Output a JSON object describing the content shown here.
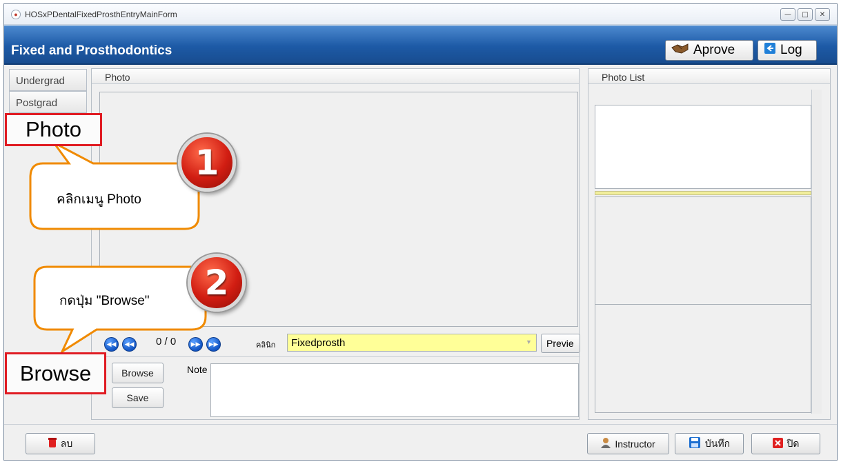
{
  "window": {
    "title": "HOSxPDentalFixedProsthEntryMainForm",
    "minimize": "—",
    "maximize": "□",
    "close": "✕"
  },
  "header": {
    "title": "Fixed and Prosthodontics",
    "approve_label": "Aprove",
    "log_label": "Log"
  },
  "tabs": [
    {
      "label": "Undergrad"
    },
    {
      "label": "Postgrad"
    }
  ],
  "photo_panel": {
    "title": "Photo",
    "page_counter": "0 / 0",
    "clinic_label": "คลินิก",
    "clinic_value": "Fixedprosth",
    "preview_label": "Previe",
    "browse_label": "Browse",
    "save_label": "Save",
    "note_label": "Note",
    "note_value": ""
  },
  "list_panel": {
    "title": "Photo List"
  },
  "footer": {
    "delete_label": "ลบ",
    "instructor_label": "Instructor",
    "save_label": "บันทึก",
    "close_label": "ปิด"
  },
  "annotations": {
    "photo_box": "Photo",
    "browse_box": "Browse",
    "callout1": "คลิกเมนู Photo",
    "callout2": "กดปุ่ม \"Browse\"",
    "badge1": "1",
    "badge2": "2"
  },
  "colors": {
    "header": "#1d5aa6",
    "clinic_field": "#ffff98",
    "highlight": "#e01b22"
  },
  "icons": {
    "app": "app-logo-icon",
    "approve": "handshake-icon",
    "log": "logout-icon",
    "delete": "trash-icon",
    "instructor": "user-icon",
    "save": "floppy-disk-icon",
    "close": "close-x-icon"
  }
}
